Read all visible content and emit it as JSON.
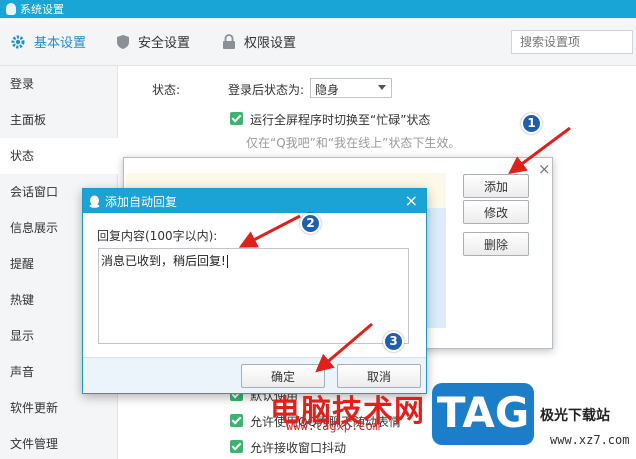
{
  "window": {
    "title": "系统设置"
  },
  "tabs": [
    {
      "label": "基本设置",
      "icon": "gear-icon",
      "active": true
    },
    {
      "label": "安全设置",
      "icon": "shield-icon",
      "active": false
    },
    {
      "label": "权限设置",
      "icon": "lock-icon",
      "active": false
    }
  ],
  "search": {
    "placeholder": "搜索设置项"
  },
  "sidebar": {
    "items": [
      {
        "label": "登录"
      },
      {
        "label": "主面板"
      },
      {
        "label": "状态",
        "active": true
      },
      {
        "label": "会话窗口"
      },
      {
        "label": "信息展示"
      },
      {
        "label": "提醒"
      },
      {
        "label": "热键"
      },
      {
        "label": "显示"
      },
      {
        "label": "声音"
      },
      {
        "label": "软件更新"
      },
      {
        "label": "文件管理"
      }
    ]
  },
  "status": {
    "section_label": "状态:",
    "after_login_label": "登录后状态为:",
    "after_login_value": "隐身",
    "fullscreen_busy_label": "运行全屏程序时切换至“忙碌”状态",
    "fullscreen_hint": "仅在“Q我吧”和“我在线上”状态下生效。",
    "bottom_options": [
      "默认使用",
      "允许使用QQ秀聊天随动表情",
      "允许接收窗口抖动"
    ]
  },
  "auto_reply_list_dialog": {
    "close_label": "×",
    "buttons": {
      "add": "添加",
      "edit": "修改",
      "delete": "删除"
    }
  },
  "add_reply_dialog": {
    "title": "添加自动回复",
    "close_label": "×",
    "content_label": "回复内容(100字以内):",
    "content_value": "消息已收到，稍后回复!",
    "ok_label": "确定",
    "cancel_label": "取消"
  },
  "annotations": {
    "badges": [
      "1",
      "2",
      "3"
    ],
    "color": "#e0211b"
  },
  "watermark": {
    "text": "电脑技术网",
    "url": "www.tagxp.com",
    "logo": "TAG",
    "site": "极光下载站",
    "site_url": "www.xz7.com"
  },
  "colors": {
    "accent": "#1aa3d4",
    "check": "#3cb371",
    "arrow": "#e0211b"
  }
}
